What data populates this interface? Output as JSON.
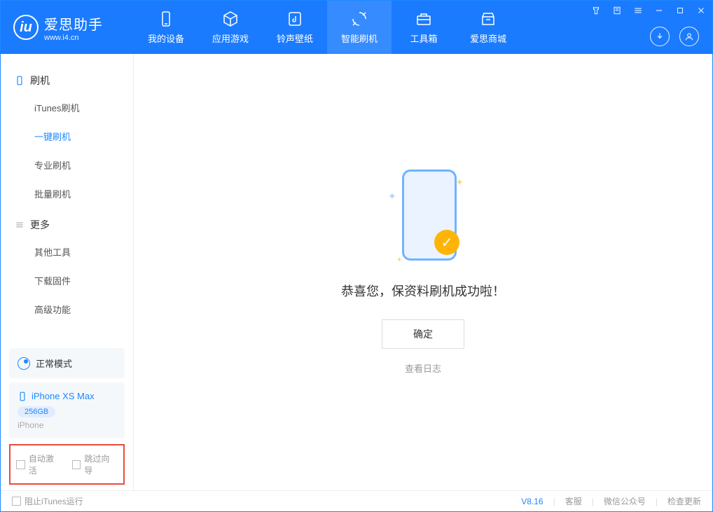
{
  "header": {
    "brand": "爱思助手",
    "site": "www.i4.cn",
    "nav": [
      {
        "label": "我的设备",
        "icon": "device"
      },
      {
        "label": "应用游戏",
        "icon": "cube"
      },
      {
        "label": "铃声壁纸",
        "icon": "music"
      },
      {
        "label": "智能刷机",
        "icon": "refresh"
      },
      {
        "label": "工具箱",
        "icon": "toolbox"
      },
      {
        "label": "爱思商城",
        "icon": "store"
      }
    ]
  },
  "sidebar": {
    "groups": [
      {
        "title": "刷机",
        "items": [
          "iTunes刷机",
          "一键刷机",
          "专业刷机",
          "批量刷机"
        ]
      },
      {
        "title": "更多",
        "items": [
          "其他工具",
          "下载固件",
          "高级功能"
        ]
      }
    ],
    "mode": "正常模式",
    "device": {
      "name": "iPhone XS Max",
      "storage": "256GB",
      "type": "iPhone"
    },
    "checks": [
      {
        "label": "自动激活"
      },
      {
        "label": "跳过向导"
      }
    ]
  },
  "main": {
    "success": "恭喜您，保资料刷机成功啦！",
    "ok": "确定",
    "log": "查看日志"
  },
  "footer": {
    "block_itunes": "阻止iTunes运行",
    "version": "V8.16",
    "links": [
      "客服",
      "微信公众号",
      "检查更新"
    ]
  }
}
